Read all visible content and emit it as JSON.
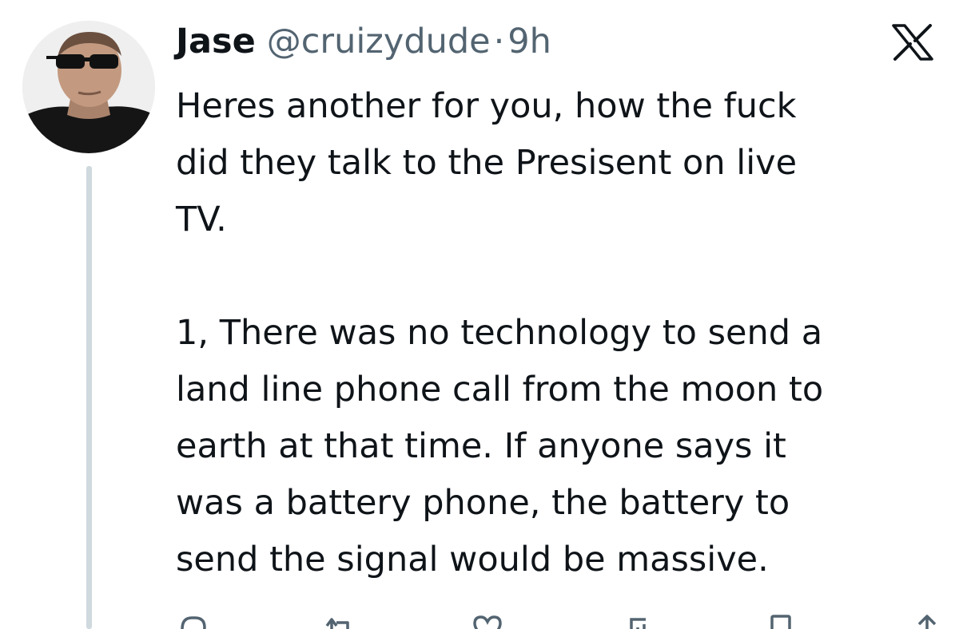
{
  "tweet": {
    "display_name": "Jase",
    "handle": "@cruizydude",
    "separator": "·",
    "time": "9h",
    "text": "Heres another for you, how the fuck\ndid they talk to the Presisent on live\nTV.\n\n1, There was no technology to send a\nland line phone call from the moon to\nearth at that time. If anyone says it\nwas a battery phone, the battery to\nsend the signal would be massive."
  },
  "icons": {
    "platform": "x-logo-icon",
    "reply": "reply-icon",
    "retweet": "retweet-icon",
    "like": "like-icon",
    "views": "views-icon",
    "bookmark": "bookmark-icon",
    "share": "share-icon"
  },
  "colors": {
    "text": "#0f1419",
    "secondary": "#536471",
    "thread_line": "#cfd9de"
  }
}
